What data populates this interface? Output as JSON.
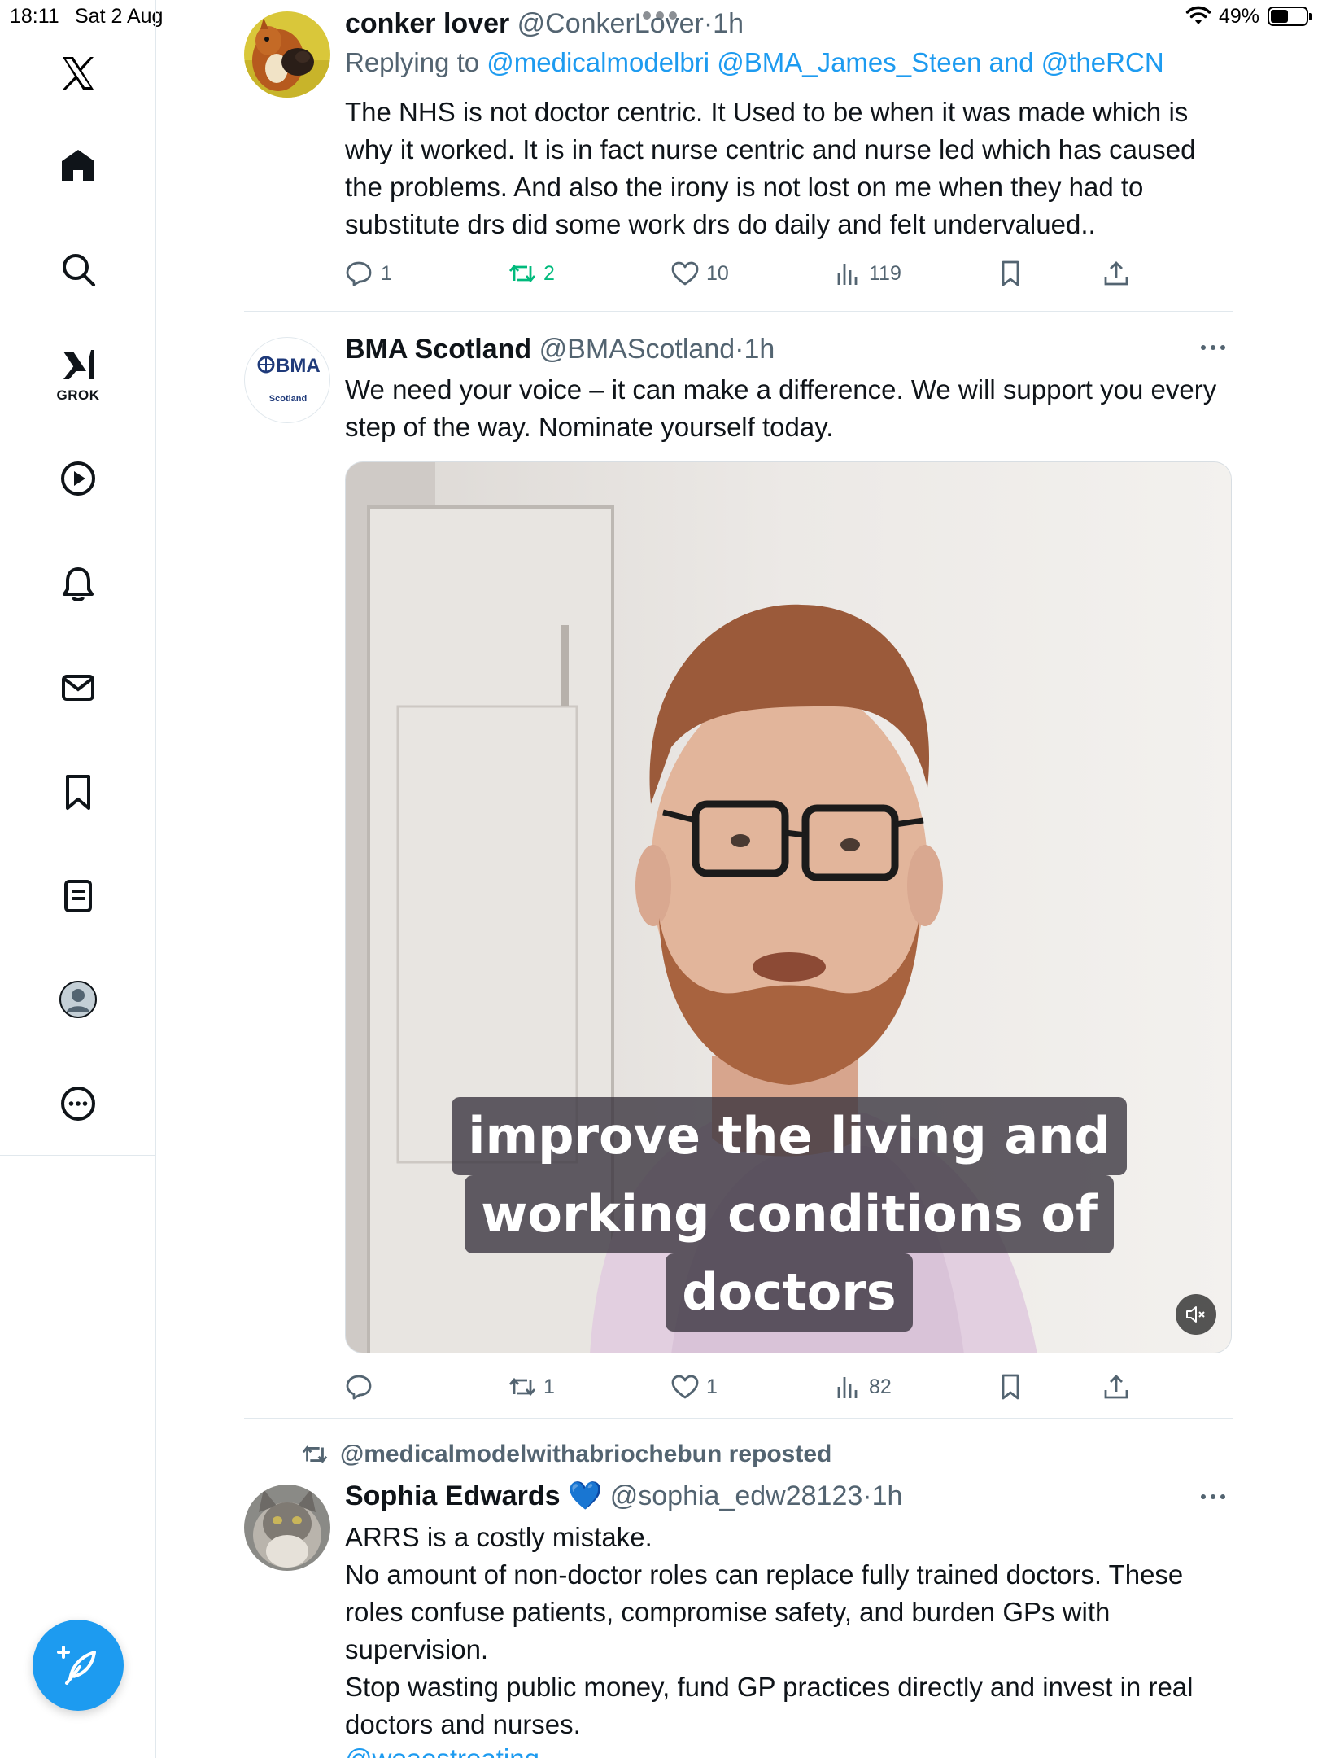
{
  "status_bar": {
    "time": "18:11",
    "date": "Sat 2 Aug",
    "battery_percent": "49%",
    "battery_level": 0.49
  },
  "sidebar": {
    "items": [
      {
        "name": "x-logo-icon",
        "label": ""
      },
      {
        "name": "home-icon",
        "label": ""
      },
      {
        "name": "search-icon",
        "label": ""
      },
      {
        "name": "grok-icon",
        "label": "GROK"
      },
      {
        "name": "video-icon",
        "label": ""
      },
      {
        "name": "notifications-icon",
        "label": ""
      },
      {
        "name": "messages-icon",
        "label": ""
      },
      {
        "name": "bookmarks-icon",
        "label": ""
      },
      {
        "name": "lists-icon",
        "label": ""
      },
      {
        "name": "profile-icon",
        "label": ""
      },
      {
        "name": "more-icon",
        "label": ""
      }
    ],
    "compose_icon": "compose-post-icon"
  },
  "colors": {
    "accent": "#1d9bf0",
    "retweet_active": "#00ba7c",
    "secondary_text": "#536471",
    "text": "#0f1419"
  },
  "tweets": [
    {
      "name": "conker lover",
      "handle": "@ConkerLover",
      "dot": "·",
      "time": "1h",
      "replying_prefix": "Replying to",
      "replying_mentions": [
        "@medicalmodelbri",
        "@BMA_James_Steen",
        "and",
        "@theRCN"
      ],
      "text": "The NHS is not doctor centric. It Used to be when it was made which is why it worked. It is in fact nurse centric and nurse led which has caused the problems. And also the irony is not lost on me when they had to substitute drs did some work drs do daily and felt undervalued..",
      "replies": "1",
      "retweets": "2",
      "likes": "10",
      "views": "119"
    },
    {
      "name": "BMA Scotland",
      "handle": "@BMAScotland",
      "dot": "·",
      "time": "1h",
      "avatar_logo": "BMA",
      "avatar_sub": "Scotland",
      "text": "We need your voice – it can make a difference.  We will support you every step of the way.  Nominate yourself today.",
      "video_caption": [
        "improve the living and",
        "working conditions of",
        "doctors"
      ],
      "replies": "",
      "retweets": "1",
      "likes": "1",
      "views": "82"
    },
    {
      "repost_by": "@medicalmodelwithabriochebun reposted",
      "name": "Sophia Edwards",
      "emoji": "💙",
      "handle": "@sophia_edw28123",
      "dot": "·",
      "time": "1h",
      "text_lines": [
        "ARRS is a costly mistake.",
        "No amount of non-doctor roles can replace fully trained doctors. These roles confuse patients, compromise safety, and burden GPs with supervision.",
        "Stop wasting public money, fund GP practices directly and invest in real doctors and nurses."
      ],
      "cut_off_mention": "@weaestreating"
    }
  ]
}
